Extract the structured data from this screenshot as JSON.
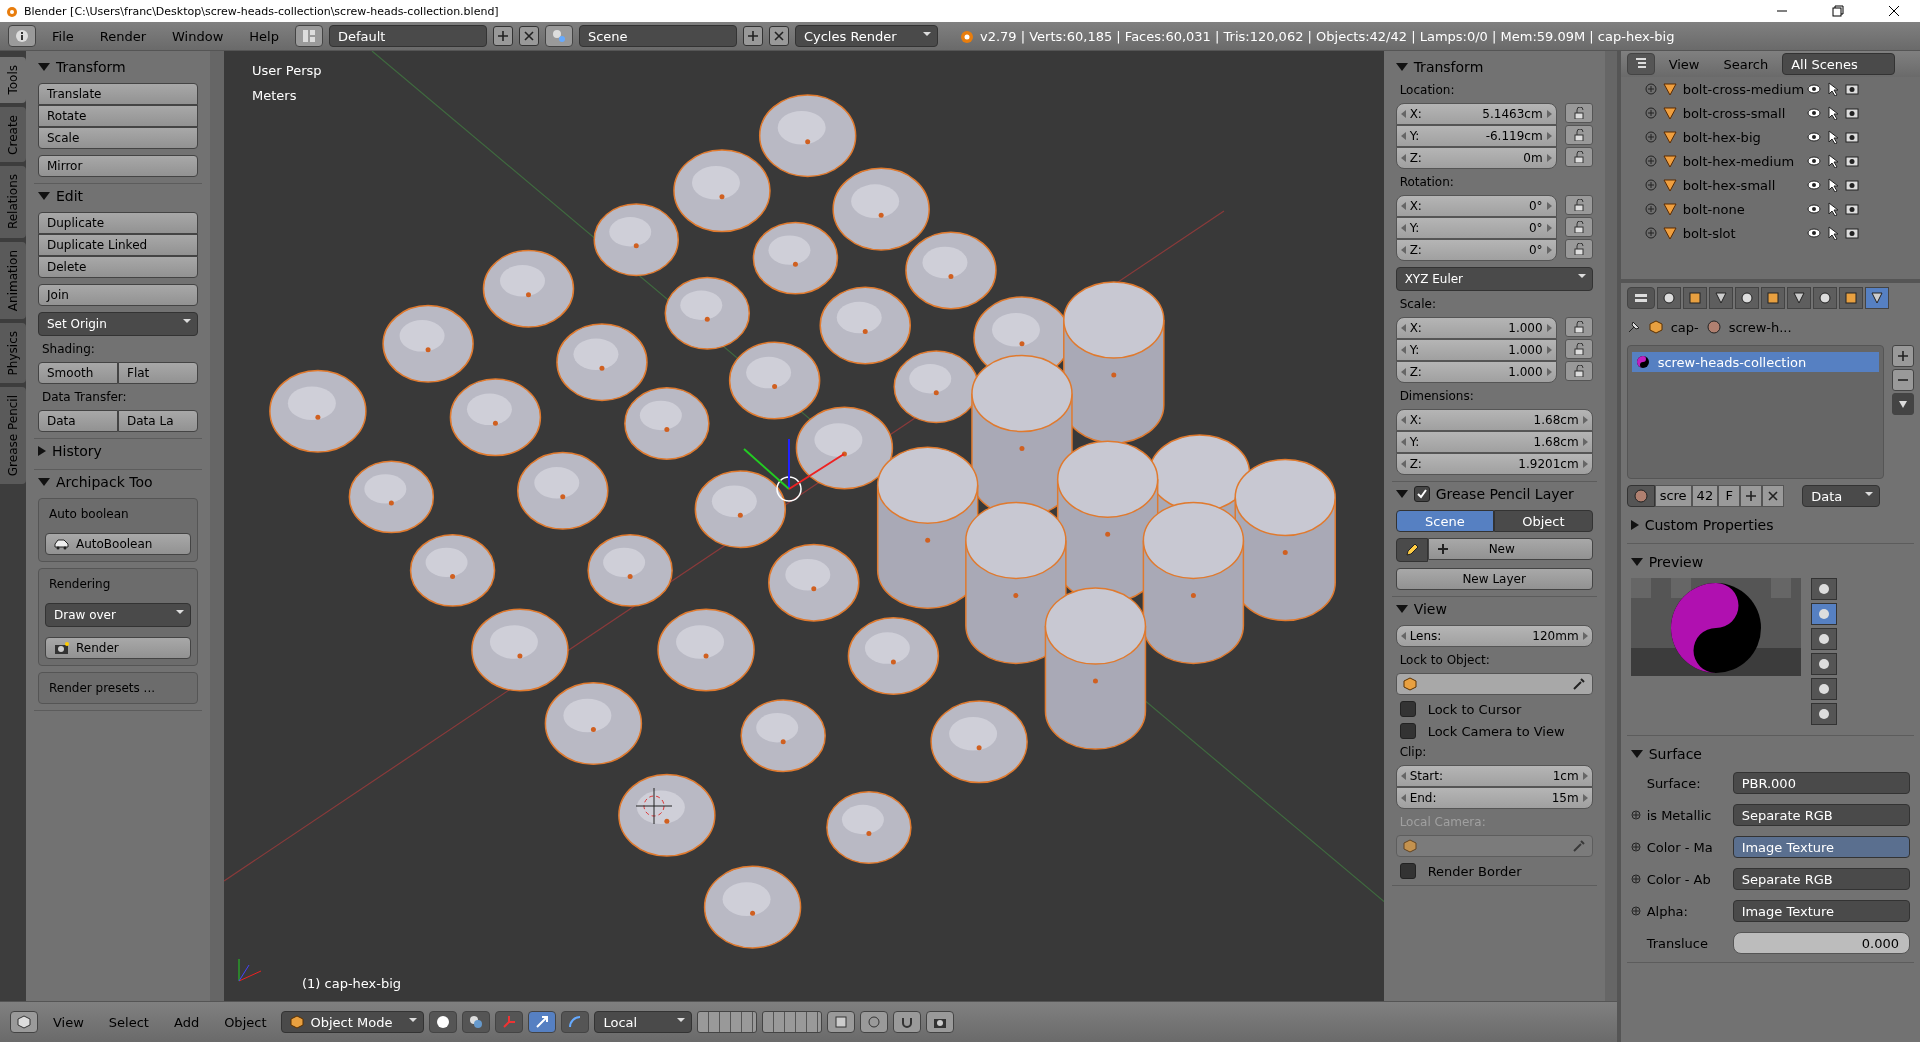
{
  "window": {
    "title": "Blender [C:\\Users\\franc\\Desktop\\screw-heads-collection\\screw-heads-collection.blend]"
  },
  "menu": [
    "File",
    "Render",
    "Window",
    "Help"
  ],
  "layout": "Default",
  "scene": "Scene",
  "engine": "Cycles Render",
  "stats": "v2.79 | Verts:60,185 | Faces:60,031 | Tris:120,062 | Objects:42/42 | Lamps:0/0 | Mem:59.09M | cap-hex-big",
  "tool_tabs": [
    {
      "label": "Tools",
      "selected": true
    },
    {
      "label": "Create",
      "selected": false
    },
    {
      "label": "Relations",
      "selected": false
    },
    {
      "label": "Animation",
      "selected": false
    },
    {
      "label": "Physics",
      "selected": false
    },
    {
      "label": "Grease Pencil",
      "selected": false
    }
  ],
  "tool_panels": [
    {
      "title": "Transform",
      "expanded": true,
      "items": [
        {
          "kind": "stack",
          "labels": [
            "Translate",
            "Rotate",
            "Scale"
          ]
        },
        {
          "kind": "button",
          "label": "Mirror"
        }
      ]
    },
    {
      "title": "Edit",
      "expanded": true,
      "items": [
        {
          "kind": "stack",
          "labels": [
            "Duplicate",
            "Duplicate Linked",
            "Delete"
          ]
        },
        {
          "kind": "button",
          "label": "Join"
        },
        {
          "kind": "dropdown",
          "label": "Set Origin"
        },
        {
          "kind": "label",
          "label": "Shading:"
        },
        {
          "kind": "pair",
          "labels": [
            "Smooth",
            "Flat"
          ]
        },
        {
          "kind": "label",
          "label": "Data Transfer:"
        },
        {
          "kind": "pair",
          "labels": [
            "Data",
            "Data La"
          ]
        }
      ]
    },
    {
      "title": "History",
      "expanded": false
    },
    {
      "title": "Archipack Too",
      "expanded": true,
      "items": [
        {
          "kind": "box",
          "items": [
            {
              "kind": "label",
              "label": "Auto boolean"
            },
            {
              "kind": "icon_button",
              "label": "AutoBoolean"
            }
          ]
        },
        {
          "kind": "box",
          "items": [
            {
              "kind": "label",
              "label": "Rendering"
            },
            {
              "kind": "dropdown",
              "label": "Draw over"
            },
            {
              "kind": "icon_button",
              "label": "Render"
            }
          ]
        },
        {
          "kind": "box",
          "items": [
            {
              "kind": "label",
              "label": "Render presets ..."
            }
          ]
        }
      ]
    }
  ],
  "viewport": {
    "view": "User Persp",
    "units": "Meters",
    "object": "(1) cap-hex-big"
  },
  "n_panels": [
    {
      "title": "Transform",
      "expanded": true,
      "items": [
        {
          "kind": "label",
          "label": "Location:"
        },
        {
          "kind": "locked_vector",
          "fields": [
            {
              "axis": "X:",
              "value": "5.1463cm"
            },
            {
              "axis": "Y:",
              "value": "-6.119cm"
            },
            {
              "axis": "Z:",
              "value": "0m"
            }
          ]
        },
        {
          "kind": "label",
          "label": "Rotation:"
        },
        {
          "kind": "locked_vector",
          "fields": [
            {
              "axis": "X:",
              "value": "0°"
            },
            {
              "axis": "Y:",
              "value": "0°"
            },
            {
              "axis": "Z:",
              "value": "0°"
            }
          ]
        },
        {
          "kind": "dropdown",
          "label": "XYZ Euler"
        },
        {
          "kind": "label",
          "label": "Scale:"
        },
        {
          "kind": "locked_vector",
          "fields": [
            {
              "axis": "X:",
              "value": "1.000"
            },
            {
              "axis": "Y:",
              "value": "1.000"
            },
            {
              "axis": "Z:",
              "value": "1.000"
            }
          ]
        },
        {
          "kind": "label",
          "label": "Dimensions:"
        },
        {
          "kind": "vector",
          "fields": [
            {
              "axis": "X:",
              "value": "1.68cm"
            },
            {
              "axis": "Y:",
              "value": "1.68cm"
            },
            {
              "axis": "Z:",
              "value": "1.9201cm"
            }
          ]
        }
      ]
    },
    {
      "title": "Grease Pencil Layer",
      "expanded": true,
      "checked": true,
      "items": [
        {
          "kind": "tabs",
          "options": [
            {
              "label": "Scene",
              "selected": true
            },
            {
              "label": "Object",
              "selected": false
            }
          ]
        },
        {
          "kind": "new_row",
          "label": "New"
        },
        {
          "kind": "button",
          "label": "New Layer"
        }
      ]
    },
    {
      "title": "View",
      "expanded": true,
      "items": [
        {
          "kind": "vector",
          "fields": [
            {
              "axis": "Lens:",
              "value": "120mm"
            }
          ]
        },
        {
          "kind": "label",
          "label": "Lock to Object:"
        },
        {
          "kind": "picker",
          "disabled": false
        },
        {
          "kind": "checkbox",
          "label": "Lock to Cursor",
          "checked": false
        },
        {
          "kind": "checkbox",
          "label": "Lock Camera to View",
          "checked": false
        },
        {
          "kind": "label",
          "label": "Clip:"
        },
        {
          "kind": "vector",
          "fields": [
            {
              "axis": "Start:",
              "value": "1cm"
            },
            {
              "axis": "End:",
              "value": "15m"
            }
          ]
        },
        {
          "kind": "label",
          "label": "Local Camera:",
          "disabled": true
        },
        {
          "kind": "picker",
          "disabled": true
        },
        {
          "kind": "checkbox",
          "label": "Render Border",
          "checked": false
        }
      ]
    }
  ],
  "outliner": {
    "menus": [
      "View",
      "Search"
    ],
    "filter": "All Scenes",
    "rows": [
      {
        "label": "bolt-cross-medium"
      },
      {
        "label": "bolt-cross-small"
      },
      {
        "label": "bolt-hex-big"
      },
      {
        "label": "bolt-hex-medium"
      },
      {
        "label": "bolt-hex-small"
      },
      {
        "label": "bolt-none"
      },
      {
        "label": "bolt-slot"
      }
    ]
  },
  "properties": {
    "tabs": [
      {
        "selected": false
      },
      {
        "selected": false
      },
      {
        "selected": false
      },
      {
        "selected": false
      },
      {
        "selected": false
      },
      {
        "selected": false
      },
      {
        "selected": false
      },
      {
        "selected": false
      },
      {
        "selected": true
      }
    ],
    "breadcrumb": [
      "cap-",
      "screw-h..."
    ],
    "slots": [
      {
        "label": "screw-heads-collection",
        "selected": true
      }
    ],
    "datablock": {
      "name": "scre",
      "users": "42",
      "fake": "F",
      "link": "Data"
    },
    "panels": [
      {
        "title": "Custom Properties",
        "expanded": false
      },
      {
        "title": "Preview",
        "kind": "preview",
        "expanded": true,
        "shapes": [
          {
            "selected": false
          },
          {
            "selected": true
          },
          {
            "selected": false
          },
          {
            "selected": false
          },
          {
            "selected": false
          },
          {
            "selected": false
          }
        ]
      },
      {
        "title": "Surface",
        "kind": "surface",
        "expanded": true,
        "rows": [
          {
            "label": "Surface:",
            "value": "PBR.000",
            "socket": false,
            "kind": "link"
          },
          {
            "label": "is Metallic",
            "value": "Separate RGB",
            "socket": true,
            "kind": "link"
          },
          {
            "label": "Color - Ma",
            "value": "Image Texture",
            "socket": true,
            "kind": "link",
            "highlighted": true
          },
          {
            "label": "Color - Ab",
            "value": "Separate RGB",
            "socket": true,
            "kind": "link"
          },
          {
            "label": "Alpha:",
            "value": "Image Texture",
            "socket": true,
            "kind": "link"
          },
          {
            "label": "Transluce",
            "value": "0.000",
            "socket": false,
            "kind": "number"
          }
        ]
      }
    ]
  },
  "bottom": {
    "menus": [
      "View",
      "Select",
      "Add",
      "Object"
    ],
    "mode": "Object Mode",
    "orientation": "Local"
  }
}
